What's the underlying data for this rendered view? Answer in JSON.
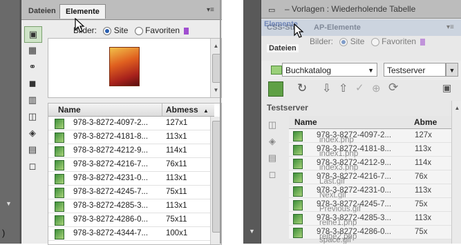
{
  "left": {
    "tabs": [
      {
        "label": "Dateien"
      },
      {
        "label": "Elemente"
      }
    ],
    "bilder_label": "Bilder:",
    "radio_site": "Site",
    "radio_favoriten": "Favoriten",
    "columns": {
      "name": "Name",
      "size": "Abmess"
    },
    "rows": [
      {
        "name": "978-3-8272-4097-2...",
        "size": "127x1"
      },
      {
        "name": "978-3-8272-4181-8...",
        "size": "113x1"
      },
      {
        "name": "978-3-8272-4212-9...",
        "size": "114x1"
      },
      {
        "name": "978-3-8272-4216-7...",
        "size": "76x11"
      },
      {
        "name": "978-3-8272-4231-0...",
        "size": "113x1"
      },
      {
        "name": "978-3-8272-4245-7...",
        "size": "75x11"
      },
      {
        "name": "978-3-8272-4285-3...",
        "size": "113x1"
      },
      {
        "name": "978-3-8272-4286-0...",
        "size": "75x11"
      },
      {
        "name": "978-3-8272-4344-7...",
        "size": "100x1"
      }
    ],
    "edge_char": ")"
  },
  "right": {
    "top_text": "– Vorlagen : Wiederholende Tabelle",
    "tabs_back": [
      {
        "label": "CSS-Sti"
      },
      {
        "label": "AP-Elemente"
      }
    ],
    "tab_elemente": "Elemente",
    "tab_dateien": "Dateien",
    "bilder_label": "Bilder:",
    "radio_site": "Site",
    "radio_favoriten": "Favoriten",
    "site_select": "Buchkatalog",
    "server_select": "Testserver",
    "group_label": "Testserver",
    "columns": {
      "name": "Name",
      "size": "Abme"
    },
    "rows": [
      {
        "name": "978-3-8272-4097-2...",
        "size": "127x",
        "overlay": "index.php"
      },
      {
        "name": "978-3-8272-4181-8...",
        "size": "113x",
        "overlay": "index1.php"
      },
      {
        "name": "978-3-8272-4212-9...",
        "size": "114x",
        "overlay": "index3.php"
      },
      {
        "name": "978-3-8272-4216-7...",
        "size": "76x",
        "overlay": "Last.gif"
      },
      {
        "name": "978-3-8272-4231-0...",
        "size": "113x",
        "overlay": "Next.gif"
      },
      {
        "name": "978-3-8272-4245-7...",
        "size": "75x",
        "overlay": "Previous.gif"
      },
      {
        "name": "978-3-8272-4285-3...",
        "size": "113x",
        "overlay": "reihe1.php"
      },
      {
        "name": "978-3-8272-4286-0...",
        "size": "75x",
        "overlay": "reihe2.php"
      }
    ],
    "tail_overlay": "space.gif"
  },
  "icons": {
    "book_cover": "book-cover-thumbnail",
    "favorites_flag": "bookmark-icon"
  }
}
